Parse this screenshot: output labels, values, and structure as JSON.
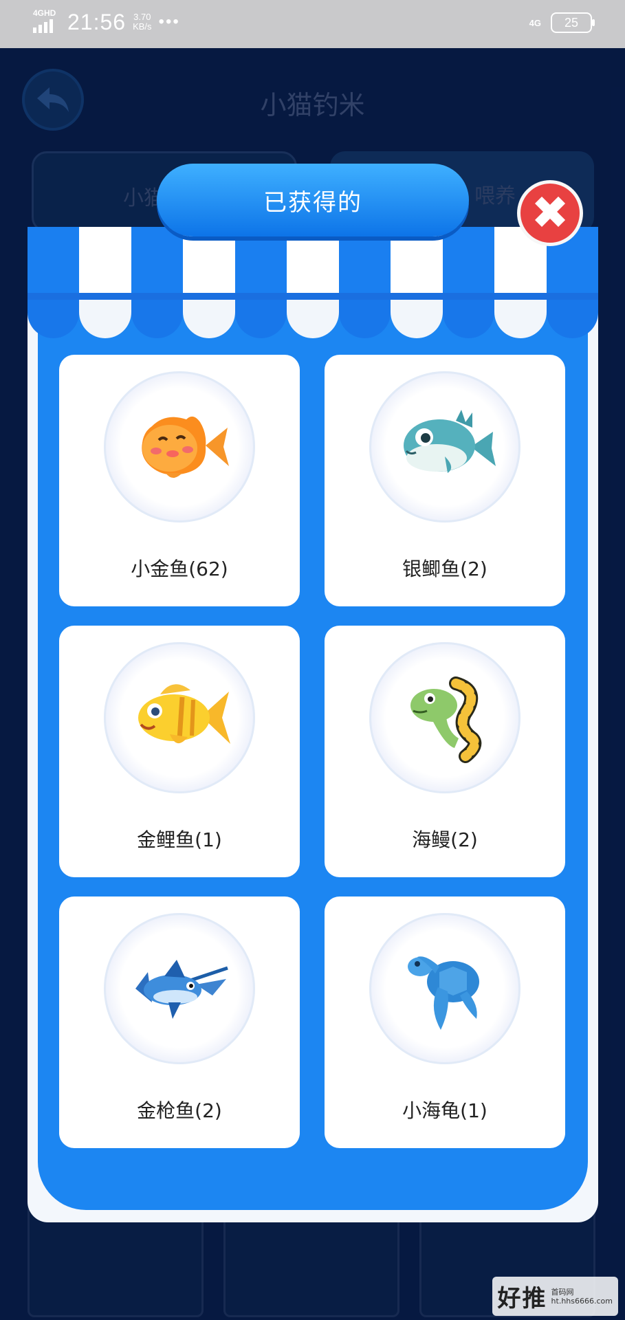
{
  "status_bar": {
    "network": "4GHD",
    "time": "21:56",
    "speed_value": "3.70",
    "speed_unit": "KB/s",
    "dots": "•••",
    "net_type": "4G",
    "battery": "25"
  },
  "background_page": {
    "title": "小猫钓米",
    "tab1_label": "小猫钓",
    "tab2_label": "喂养"
  },
  "modal": {
    "banner_title": "已获得的",
    "close_glyph": "✖",
    "items": [
      {
        "label": "小金鱼(62)",
        "icon": "goldfish-icon"
      },
      {
        "label": "银鲫鱼(2)",
        "icon": "pufferfish-icon"
      },
      {
        "label": "金鲤鱼(1)",
        "icon": "striped-fish-icon"
      },
      {
        "label": "海鳗(2)",
        "icon": "eel-icon"
      },
      {
        "label": "金枪鱼(2)",
        "icon": "swordfish-icon"
      },
      {
        "label": "小海龟(1)",
        "icon": "turtle-icon"
      }
    ]
  },
  "watermark": {
    "logo": "好推",
    "site_name": "首码网",
    "url": "ht.hhs6666.com"
  },
  "colors": {
    "primary_blue": "#1c86f2",
    "close_red": "#e84141",
    "background": "#0b2a63"
  }
}
